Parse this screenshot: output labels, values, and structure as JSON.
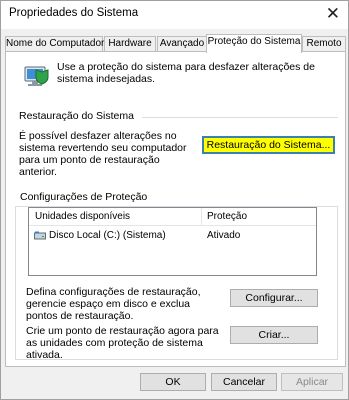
{
  "window": {
    "title": "Propriedades do Sistema",
    "close_glyph": "✕"
  },
  "tabs": [
    {
      "label": "Nome do Computador"
    },
    {
      "label": "Hardware"
    },
    {
      "label": "Avançado"
    },
    {
      "label": "Proteção do Sistema",
      "active": true
    },
    {
      "label": "Remoto"
    }
  ],
  "intro": {
    "icon": "shield-computer-icon",
    "text": "Use a proteção do sistema para desfazer alterações de sistema indesejadas."
  },
  "restore_section": {
    "title": "Restauração do Sistema",
    "description": "É possível desfazer alterações no sistema revertendo seu computador para um ponto de restauração anterior.",
    "button_label": "Restauração do Sistema..."
  },
  "protection_section": {
    "title": "Configurações de Proteção",
    "columns": [
      "Unidades disponíveis",
      "Proteção"
    ],
    "rows": [
      {
        "icon": "disk-drive-icon",
        "drive": "Disco Local (C:) (Sistema)",
        "protection": "Ativado"
      }
    ],
    "configure_text": "Defina configurações de restauração, gerencie espaço em disco e exclua pontos de restauração.",
    "configure_button": "Configurar...",
    "create_text": "Crie um ponto de restauração agora para as unidades com proteção de sistema ativada.",
    "create_button": "Criar..."
  },
  "footer": {
    "ok": "OK",
    "cancel": "Cancelar",
    "apply": "Aplicar"
  },
  "colors": {
    "highlight_button": "#ffff00",
    "focus_border": "#3c7fb1"
  }
}
